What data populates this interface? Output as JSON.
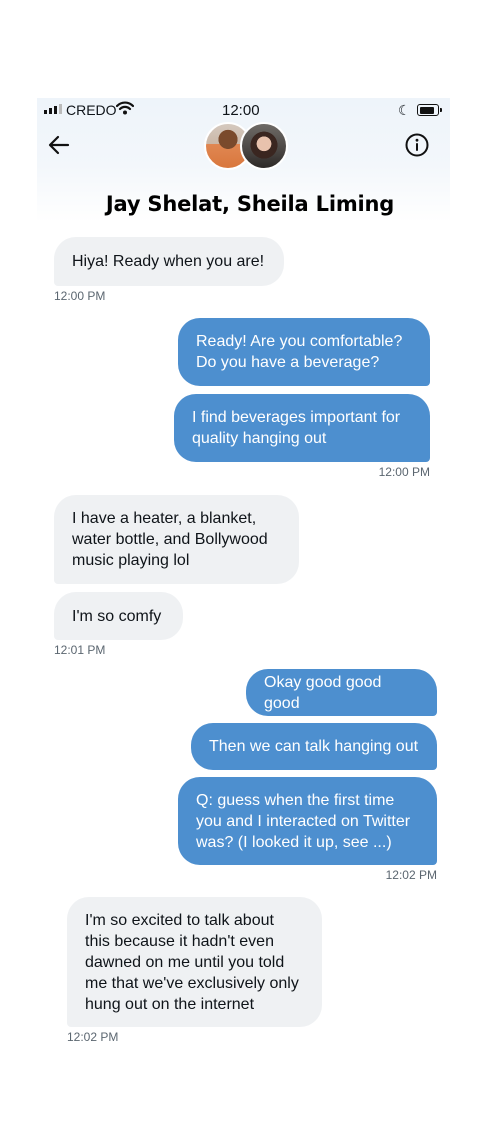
{
  "status_bar": {
    "carrier": "CREDO",
    "time": "12:00"
  },
  "conversation": {
    "title": "Jay Shelat, Sheila Liming"
  },
  "messages": [
    {
      "text": "Hiya! Ready when you are!"
    },
    {
      "text": "Ready! Are you comfortable?\nDo you have a beverage?"
    },
    {
      "text": "I find beverages important for\nquality hanging out"
    },
    {
      "text": "I have a heater, a blanket,\nwater bottle, and Bollywood\nmusic playing lol"
    },
    {
      "text": "I'm so comfy"
    },
    {
      "text": "Okay good good good"
    },
    {
      "text": "Then we can talk hanging out"
    },
    {
      "text": "Q: guess when the first time\nyou and I interacted on Twitter\nwas? (I looked it up, see ...)"
    },
    {
      "text": "I'm so excited to talk about\nthis because it hadn't even\ndawned on me until you told\nme that we've exclusively only\nhung out on the internet"
    }
  ],
  "timestamps": [
    "12:00 PM",
    "12:00 PM",
    "12:01 PM",
    "12:02 PM",
    "12:02 PM"
  ],
  "icons": {
    "back": "arrow-left-icon",
    "info": "info-icon"
  },
  "colors": {
    "sent_bubble": "#4d8fcf",
    "received_bubble": "#eff1f3"
  }
}
